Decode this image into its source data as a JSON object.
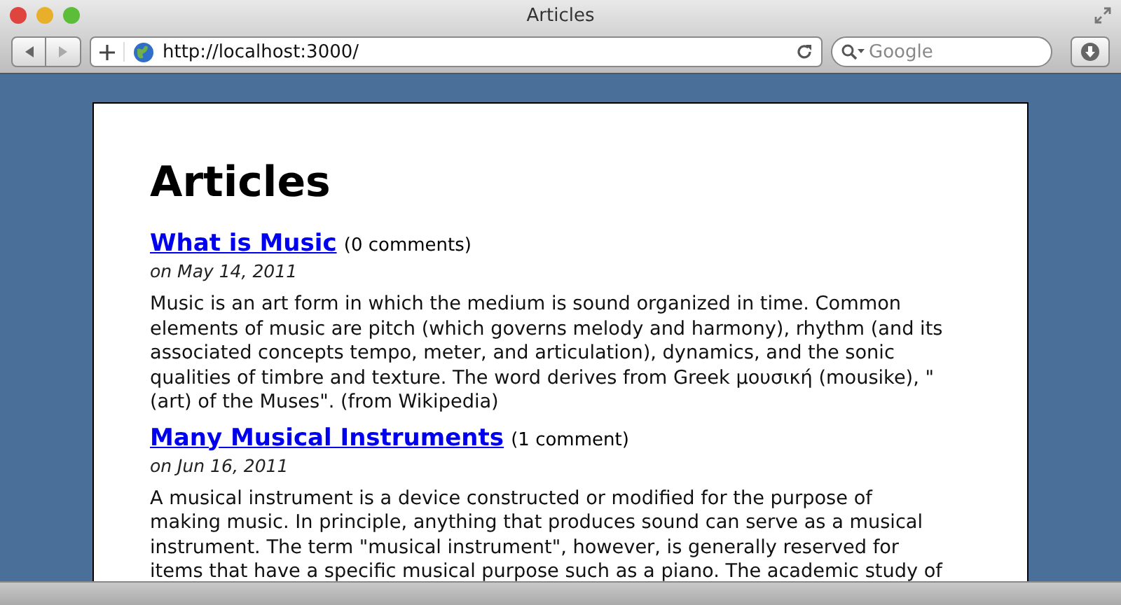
{
  "window": {
    "title": "Articles"
  },
  "toolbar": {
    "url": "http://localhost:3000/",
    "search": {
      "placeholder": "Google"
    }
  },
  "page": {
    "heading": "Articles",
    "articles": [
      {
        "title": "What is Music",
        "comments": "(0 comments)",
        "date": "on May 14, 2011",
        "body_lines": [
          "Music is an art form in which the medium is sound organized in time. Common",
          "elements of music are pitch (which governs melody and harmony), rhythm (and its",
          "associated concepts tempo, meter, and articulation), dynamics, and the sonic",
          "qualities of timbre and texture. The word derives from Greek μουσική (mousike), \"",
          "(art) of the Muses\". (from Wikipedia)"
        ]
      },
      {
        "title": "Many Musical Instruments",
        "comments": "(1 comment)",
        "date": "on Jun 16, 2011",
        "body_lines": [
          "A musical instrument is a device constructed or modified for the purpose of",
          "making music. In principle, anything that produces sound can serve as a musical",
          "instrument. The term \"musical instrument\", however, is generally reserved for",
          "items that have a specific musical purpose such as a piano. The academic study of"
        ]
      }
    ]
  }
}
